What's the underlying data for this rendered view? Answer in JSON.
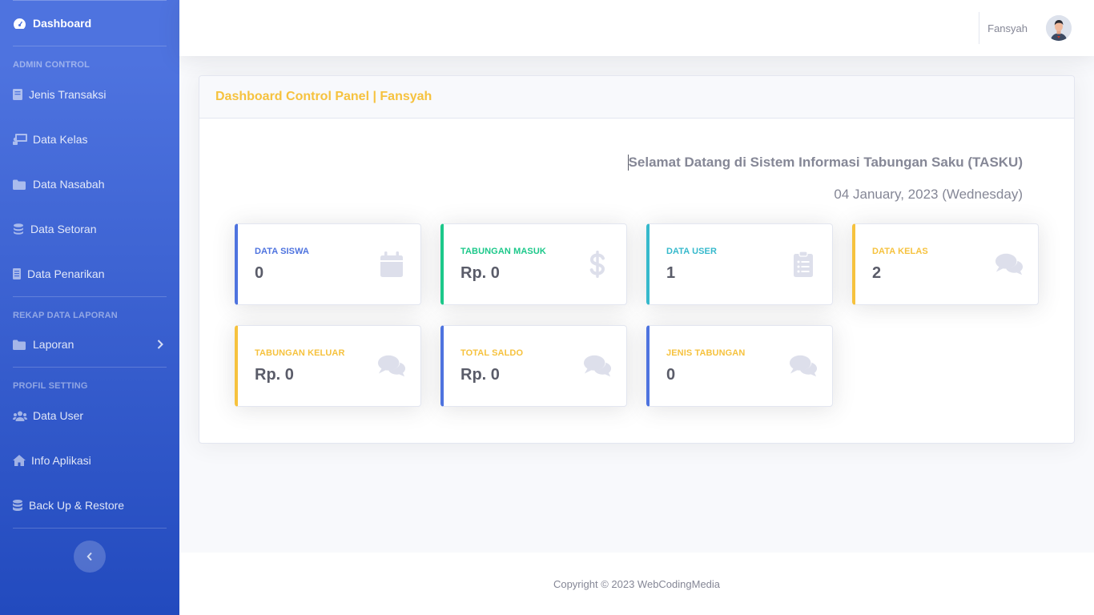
{
  "colors": {
    "primary": "#4e73df",
    "success": "#1cc88a",
    "info": "#36b9cc",
    "warning": "#f6c23e",
    "icon_muted": "#dddfeb"
  },
  "sidebar": {
    "dashboard": {
      "label": "Dashboard",
      "icon": "tachometer-icon"
    },
    "heading_admin": "ADMIN CONTROL",
    "admin_items": [
      {
        "label": "Jenis Transaksi",
        "icon": "book-icon"
      },
      {
        "label": "Data Kelas",
        "icon": "chalkboard-icon"
      },
      {
        "label": "Data Nasabah",
        "icon": "folder-icon"
      },
      {
        "label": "Data Setoran",
        "icon": "coins-icon"
      },
      {
        "label": "Data Penarikan",
        "icon": "file-icon"
      }
    ],
    "heading_rekap": "REKAP DATA LAPORAN",
    "laporan": {
      "label": "Laporan",
      "icon": "folder-icon"
    },
    "heading_profil": "PROFIL SETTING",
    "profil_items": [
      {
        "label": "Data User",
        "icon": "users-icon"
      },
      {
        "label": "Info Aplikasi",
        "icon": "home-icon"
      },
      {
        "label": "Back Up & Restore",
        "icon": "database-icon"
      }
    ]
  },
  "topbar": {
    "username": "Fansyah"
  },
  "card": {
    "title": "Dashboard Control Panel | Fansyah",
    "welcome": "Selamat Datang di Sistem Informasi Tabungan Saku (TASKU)",
    "date": "04 January, 2023 (Wednesday)"
  },
  "tiles": [
    {
      "label": "DATA SISWA",
      "value": "0",
      "color": "primary",
      "icon": "calendar-icon"
    },
    {
      "label": "TABUNGAN MASUK",
      "value": "Rp. 0",
      "color": "success",
      "icon": "dollar-icon"
    },
    {
      "label": "DATA USER",
      "value": "1",
      "color": "info",
      "icon": "clipboard-list-icon"
    },
    {
      "label": "DATA KELAS",
      "value": "2",
      "color": "warning",
      "icon": "comments-icon"
    },
    {
      "label": "TABUNGAN KELUAR",
      "value": "Rp. 0",
      "color": "warning",
      "icon": "comments-icon"
    },
    {
      "label": "TOTAL SALDO",
      "value": "Rp. 0",
      "color": "primary",
      "icon": "comments-icon"
    },
    {
      "label": "JENIS TABUNGAN",
      "value": "0",
      "color": "primary",
      "icon": "comments-icon"
    }
  ],
  "footer": {
    "copyright": "Copyright © 2023 WebCodingMedia"
  }
}
